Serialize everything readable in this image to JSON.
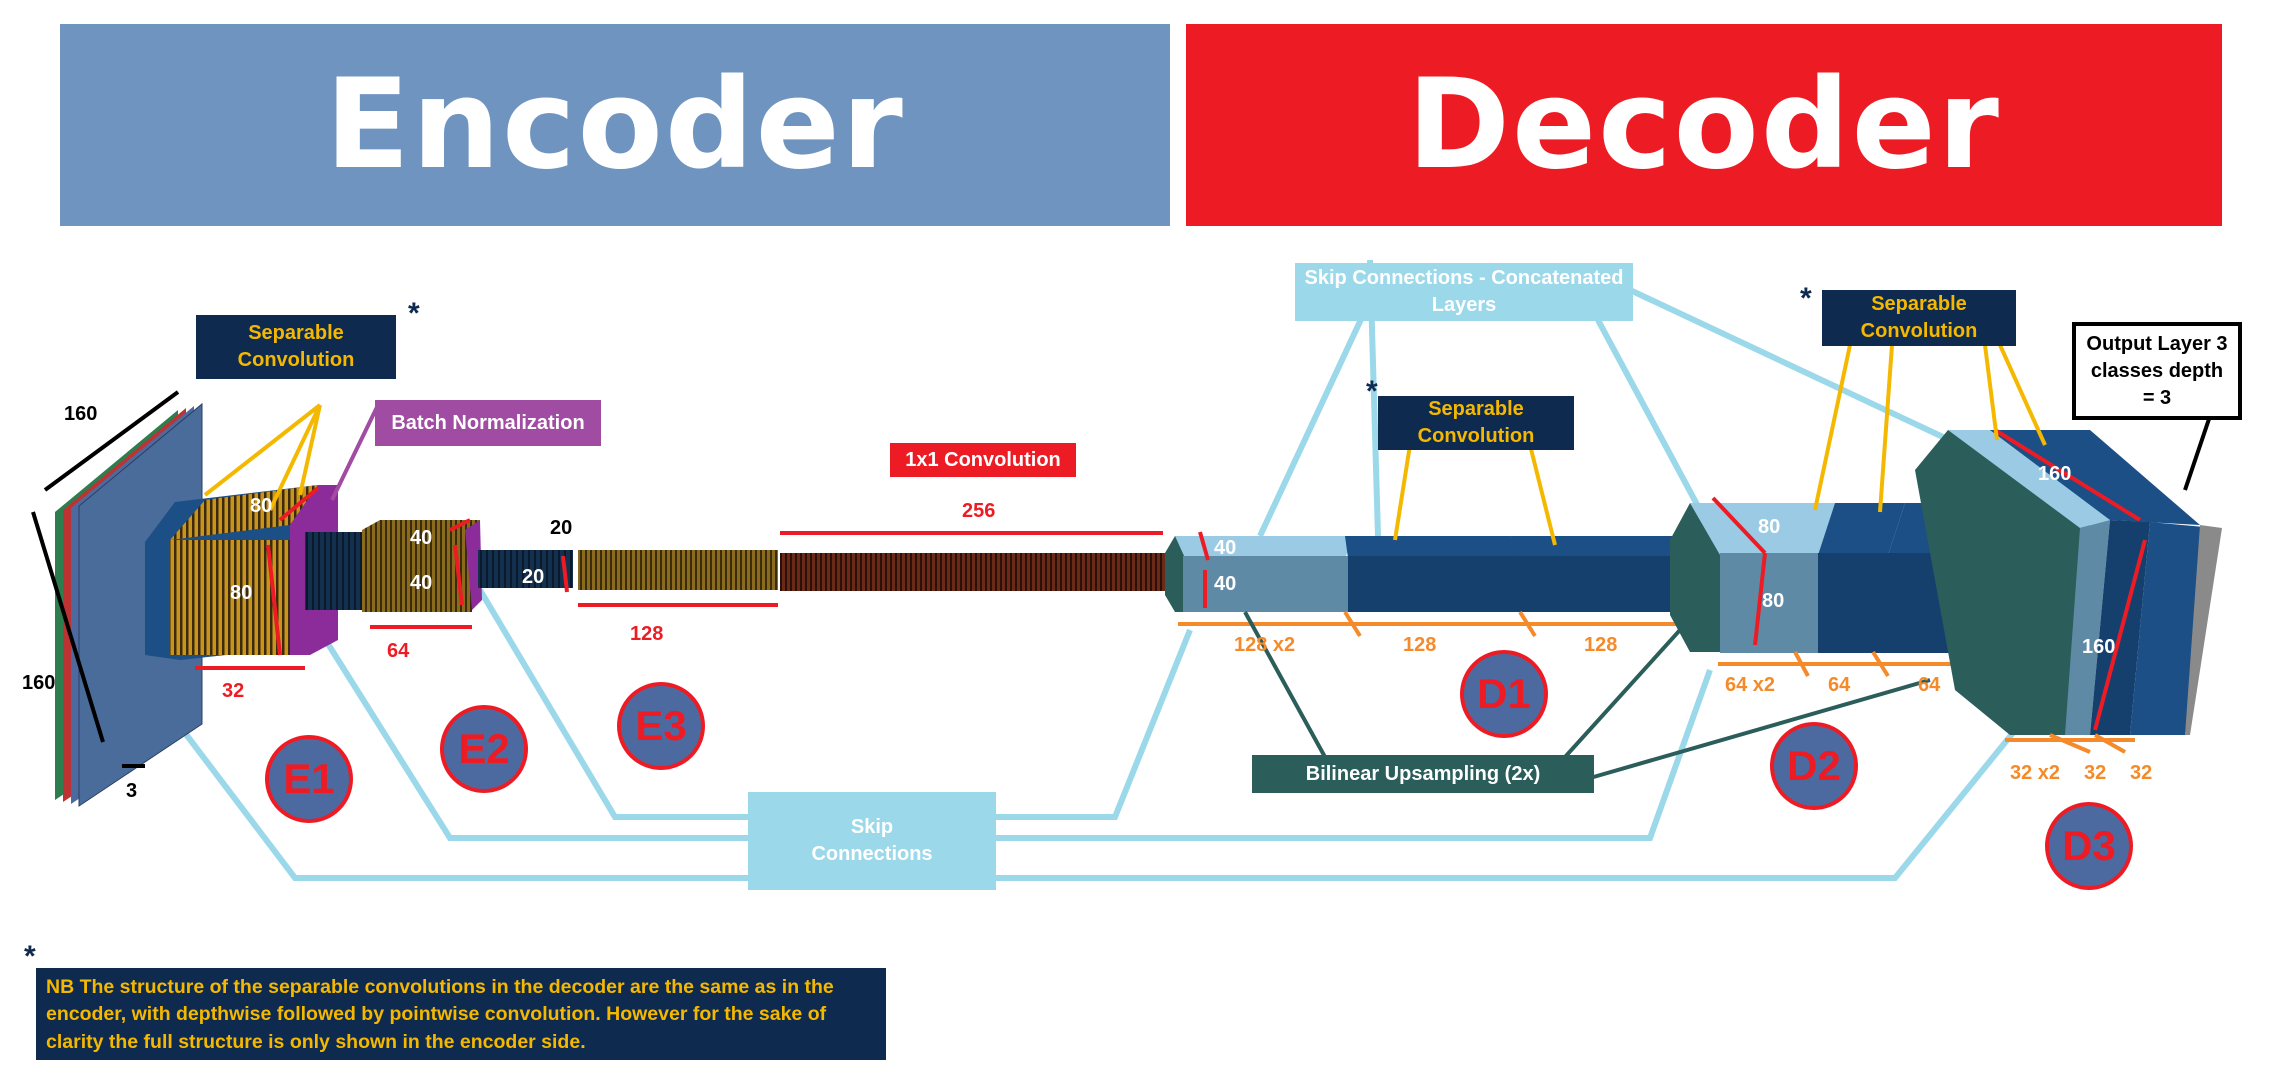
{
  "banners": {
    "encoder": "Encoder",
    "decoder": "Decoder"
  },
  "labels": {
    "sep_conv_enc": "Separable Convolution",
    "batch_norm": "Batch Normalization",
    "conv_1x1": "1x1 Convolution",
    "skip_concat": "Skip Connections - Concatenated Layers",
    "sep_conv_dec1": "Separable Convolution",
    "sep_conv_dec2": "Separable Convolution",
    "output_layer": "Output Layer 3 classes depth = 3",
    "bilinear": "Bilinear Upsampling (2x)",
    "skip": "Skip Connections",
    "star": "*"
  },
  "note": "NB The structure of the separable convolutions in the decoder are the same as in the encoder, with depthwise followed by pointwise convolution. However for the sake of clarity the full structure is only shown in the encoder side.",
  "stages": {
    "e1": "E1",
    "e2": "E2",
    "e3": "E3",
    "d1": "D1",
    "d2": "D2",
    "d3": "D3"
  },
  "dims": {
    "input_w": "160",
    "input_h": "160",
    "input_d": "3",
    "e1_w": "80",
    "e1_h": "80",
    "e1_d": "32",
    "e2_w": "40",
    "e2_h": "40",
    "e2_d": "64",
    "e3_w": "20",
    "e3_h": "20",
    "e3_d": "128",
    "conv1x1_d": "256",
    "d1_w": "40",
    "d1_h": "40",
    "d1_concat": "128 x2",
    "d1_s1": "128",
    "d1_s2": "128",
    "d2_w": "80",
    "d2_h": "80",
    "d2_concat": "64 x2",
    "d2_s1": "64",
    "d2_s2": "64",
    "d3_w": "160",
    "d3_h": "160",
    "d3_concat": "32 x2",
    "d3_s1": "32",
    "d3_s2": "32"
  },
  "colors": {
    "encoder_banner": "#7094c0",
    "decoder_banner": "#ed1c24",
    "navy": "#0e2a4e",
    "yellow": "#f5b800",
    "red": "#ed1c24",
    "skip_line": "#9bd8ea",
    "teal": "#2b5e5a",
    "orange": "#f58a2a"
  }
}
